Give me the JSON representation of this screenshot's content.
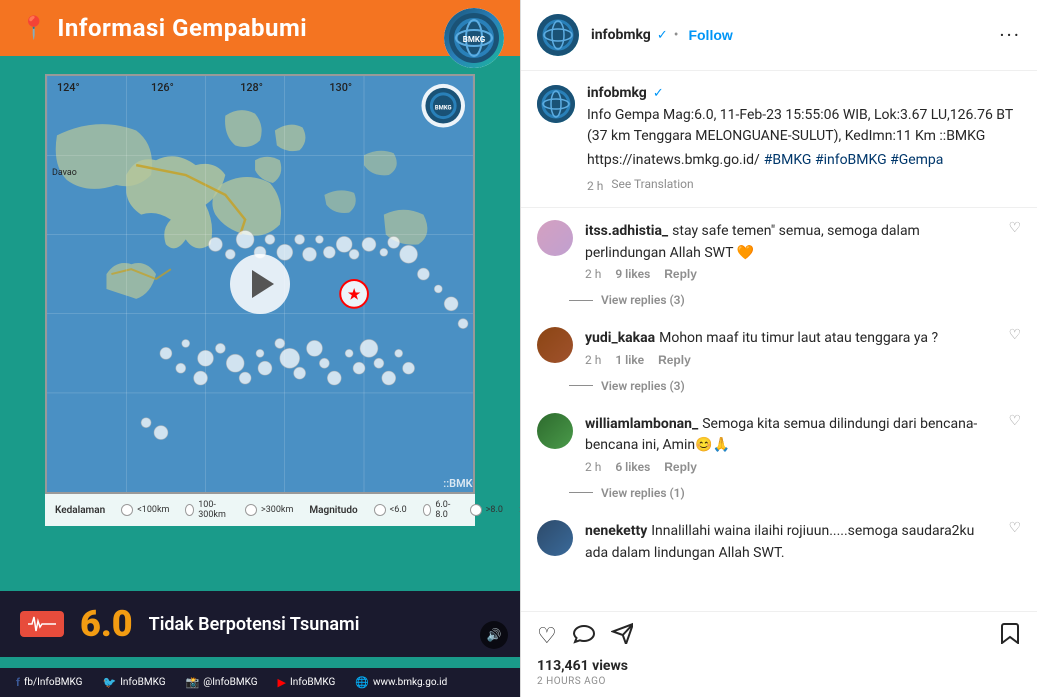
{
  "header": {
    "username": "infobmkg",
    "verified": "✓",
    "follow_label": "Follow",
    "more_options": "...",
    "dot": "•"
  },
  "caption": {
    "username": "infobmkg",
    "verified": "✓",
    "text": "Info Gempa Mag:6.0, 11-Feb-23 15:55:06 WIB, Lok:3.67 LU,126.76 BT (37 km Tenggara MELONGUANE-SULUT), KedImn:11 Km ::BMKG",
    "link": "https://inatews.bmkg.go.id/",
    "hashtags": "#BMKG #infoBMKG #Gempa",
    "time": "2 h",
    "see_translation": "See Translation"
  },
  "comments": [
    {
      "username": "itss.adhistia_",
      "text": "stay safe temen\" semua, semoga dalam perlindungan Allah SWT 🧡",
      "time": "2 h",
      "likes": "9 likes",
      "reply_label": "Reply",
      "view_replies": "View replies (3)",
      "avatar_class": "comment-avatar-1"
    },
    {
      "username": "yudi_kakaa",
      "text": "Mohon maaf itu timur laut atau tenggara ya ?",
      "time": "2 h",
      "likes": "1 like",
      "reply_label": "Reply",
      "view_replies": "View replies (3)",
      "avatar_class": "comment-avatar-2"
    },
    {
      "username": "williamlambonan_",
      "text": "Semoga kita semua dilindungi dari bencana-bencana ini, Amin😊🙏",
      "time": "2 h",
      "likes": "6 likes",
      "reply_label": "Reply",
      "view_replies": "View replies (1)",
      "avatar_class": "comment-avatar-3"
    },
    {
      "username": "neneketty",
      "text": "Innalillahi waina ilaihi rojiuun.....semoga saudara2ku ada dalam lindungan Allah SWT.",
      "time": "",
      "likes": "",
      "reply_label": "",
      "view_replies": "",
      "avatar_class": "comment-avatar-4"
    }
  ],
  "post_info": {
    "views": "113,461 views",
    "time_ago": "2 HOURS AGO"
  },
  "image": {
    "title": "Informasi Gempabumi",
    "magnitude": "6.0",
    "tsunami_text": "Tidak Berpotensi Tsunami",
    "bmkg_label": "BMKG",
    "volume_icon": "🔊"
  },
  "legend": {
    "depth_label": "Kedalaman",
    "mag_label": "Magnitudo",
    "items": [
      {
        "label": "<100km",
        "color": "white"
      },
      {
        "label": "100-300km",
        "color": "white"
      },
      {
        "label": ">300km",
        "color": "white"
      },
      {
        "label": "<6.0",
        "color": "white"
      },
      {
        "label": "6.0-8.0",
        "color": "white"
      },
      {
        "label": ">8.0",
        "color": "white"
      }
    ]
  },
  "social_links": [
    {
      "label": "fb/InfoBMKG"
    },
    {
      "label": "InfoBMKG"
    },
    {
      "label": "@InfoBMKG"
    },
    {
      "label": "InfoBMKG"
    },
    {
      "label": "www.bmkg.go.id"
    }
  ]
}
